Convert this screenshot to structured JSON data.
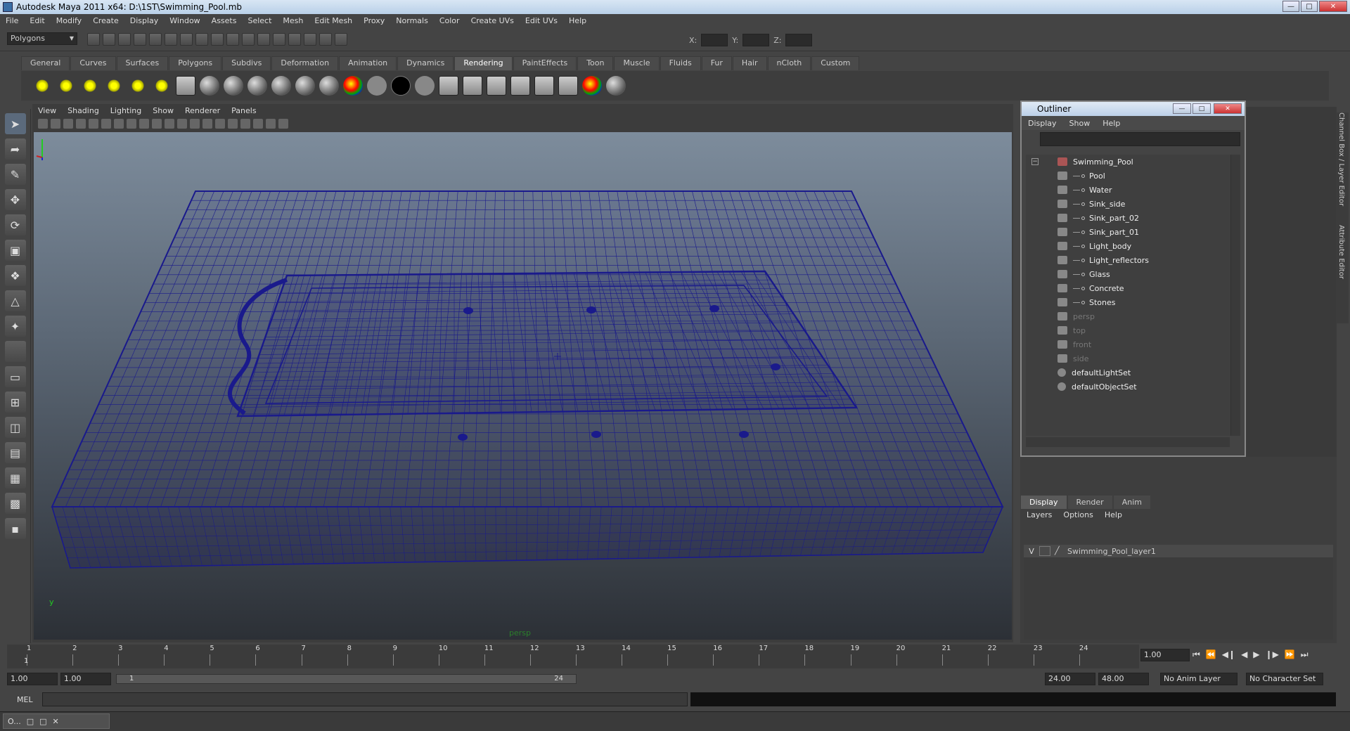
{
  "window": {
    "title": "Autodesk Maya 2011 x64: D:\\1ST\\Swimming_Pool.mb"
  },
  "menu": [
    "File",
    "Edit",
    "Modify",
    "Create",
    "Display",
    "Window",
    "Assets",
    "Select",
    "Mesh",
    "Edit Mesh",
    "Proxy",
    "Normals",
    "Color",
    "Create UVs",
    "Edit UVs",
    "Help"
  ],
  "status": {
    "mode": "Polygons",
    "x_label": "X:",
    "y_label": "Y:",
    "z_label": "Z:"
  },
  "shelf_tabs": [
    "General",
    "Curves",
    "Surfaces",
    "Polygons",
    "Subdivs",
    "Deformation",
    "Animation",
    "Dynamics",
    "Rendering",
    "PaintEffects",
    "Toon",
    "Muscle",
    "Fluids",
    "Fur",
    "Hair",
    "nCloth",
    "Custom"
  ],
  "shelf_active": "Rendering",
  "viewport": {
    "menu": [
      "View",
      "Shading",
      "Lighting",
      "Show",
      "Renderer",
      "Panels"
    ],
    "camera_label": "persp",
    "axis_y": "y",
    "wire_color": "#1a1a8c"
  },
  "outliner": {
    "title": "Outliner",
    "menu": [
      "Display",
      "Show",
      "Help"
    ],
    "root": "Swimming_Pool",
    "children": [
      "Pool",
      "Water",
      "Sink_side",
      "Sink_part_02",
      "Sink_part_01",
      "Light_body",
      "Light_reflectors",
      "Glass",
      "Concrete",
      "Stones"
    ],
    "cameras": [
      "persp",
      "top",
      "front",
      "side"
    ],
    "sets": [
      "defaultLightSet",
      "defaultObjectSet"
    ]
  },
  "side_tab": "Channel Box / Layer Editor",
  "side_tab2": "Attribute Editor",
  "layer_editor": {
    "tabs": [
      "Display",
      "Render",
      "Anim"
    ],
    "menu": [
      "Layers",
      "Options",
      "Help"
    ],
    "layer": {
      "visibility": "V",
      "name": "Swimming_Pool_layer1"
    }
  },
  "timeline": {
    "ticks": [
      "1",
      "2",
      "3",
      "4",
      "5",
      "6",
      "7",
      "8",
      "9",
      "10",
      "11",
      "12",
      "13",
      "14",
      "15",
      "16",
      "17",
      "18",
      "19",
      "20",
      "21",
      "22",
      "23",
      "24"
    ],
    "current_frame_value": "1",
    "current_frame": "1.00"
  },
  "range": {
    "start": "1.00",
    "playback_start": "1.00",
    "slider_start": "1",
    "slider_end": "24",
    "playback_end": "24.00",
    "end": "48.00",
    "anim_layer": "No Anim Layer",
    "character_set": "No Character Set"
  },
  "cmd": {
    "label": "MEL"
  },
  "taskbar": {
    "item": "O..."
  }
}
